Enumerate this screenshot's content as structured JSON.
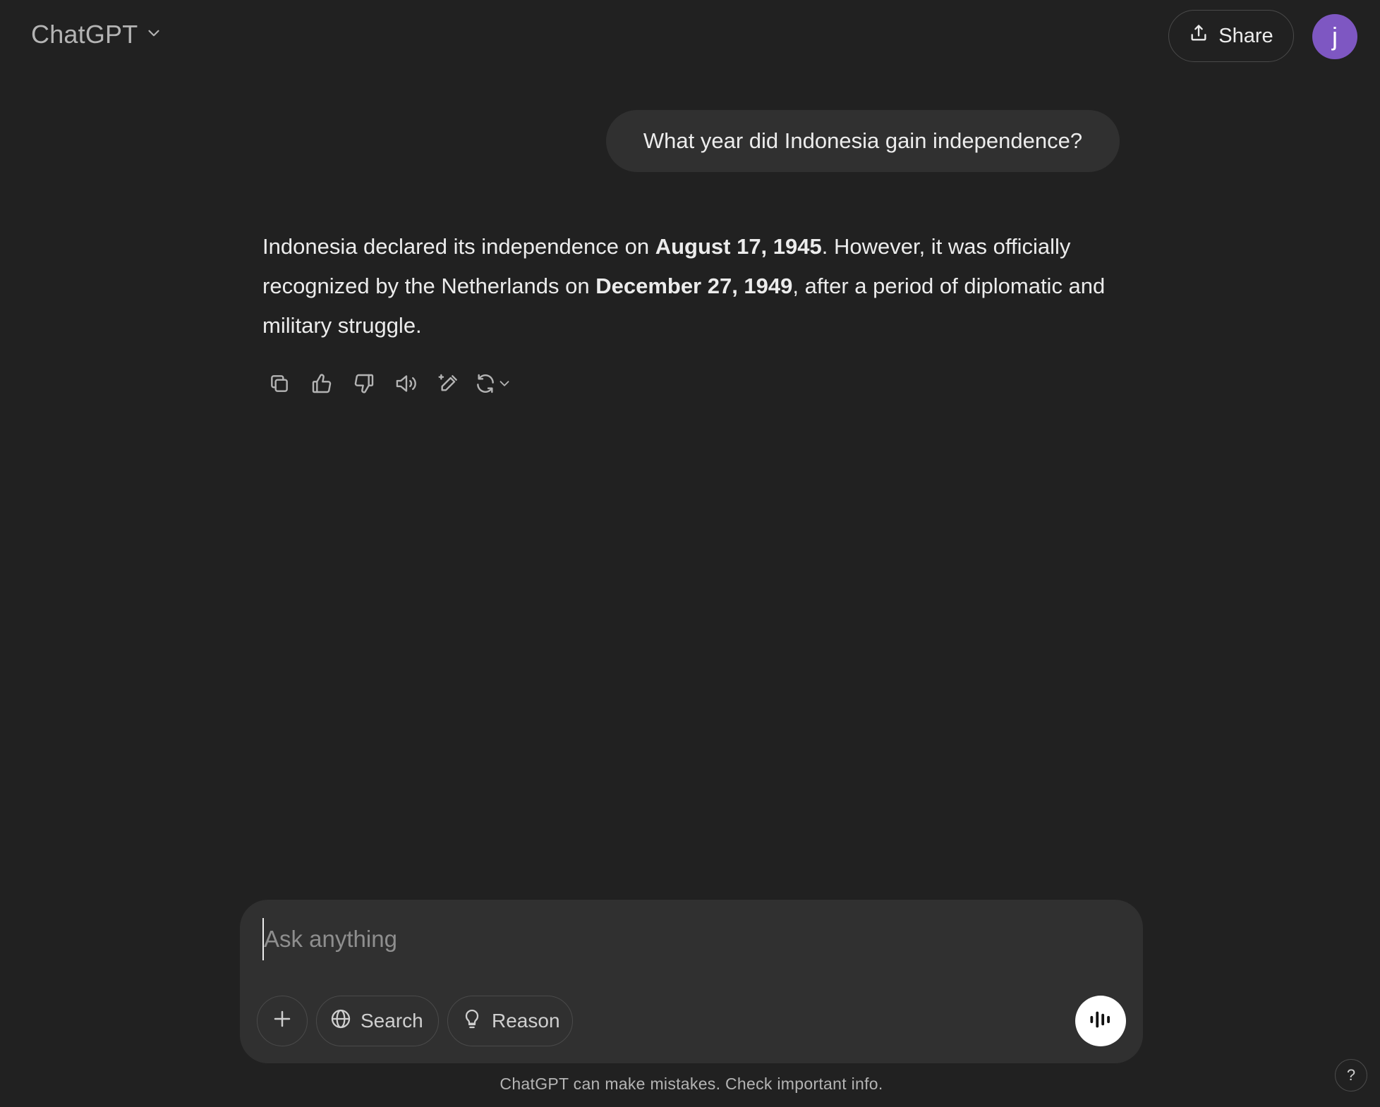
{
  "header": {
    "model_name": "ChatGPT",
    "share_label": "Share",
    "avatar_letter": "j",
    "avatar_color": "#7e57c2"
  },
  "conversation": {
    "user_message": "What year did Indonesia gain independence?",
    "assistant_message": {
      "part1": "Indonesia declared its independence on ",
      "bold1": "August 17, 1945",
      "part2": ". However, it was officially recognized by the Netherlands on ",
      "bold2": "December 27, 1949",
      "part3": ", after a period of diplomatic and military struggle."
    },
    "actions": [
      "copy-icon",
      "thumbs-up-icon",
      "thumbs-down-icon",
      "read-aloud-icon",
      "edit-canvas-icon",
      "regenerate-icon"
    ]
  },
  "composer": {
    "placeholder": "Ask anything",
    "search_label": "Search",
    "reason_label": "Reason"
  },
  "footer": {
    "disclaimer": "ChatGPT can make mistakes. Check important info.",
    "help_label": "?"
  },
  "colors": {
    "background": "#212121",
    "bubble": "#303030",
    "text": "#ececec"
  }
}
